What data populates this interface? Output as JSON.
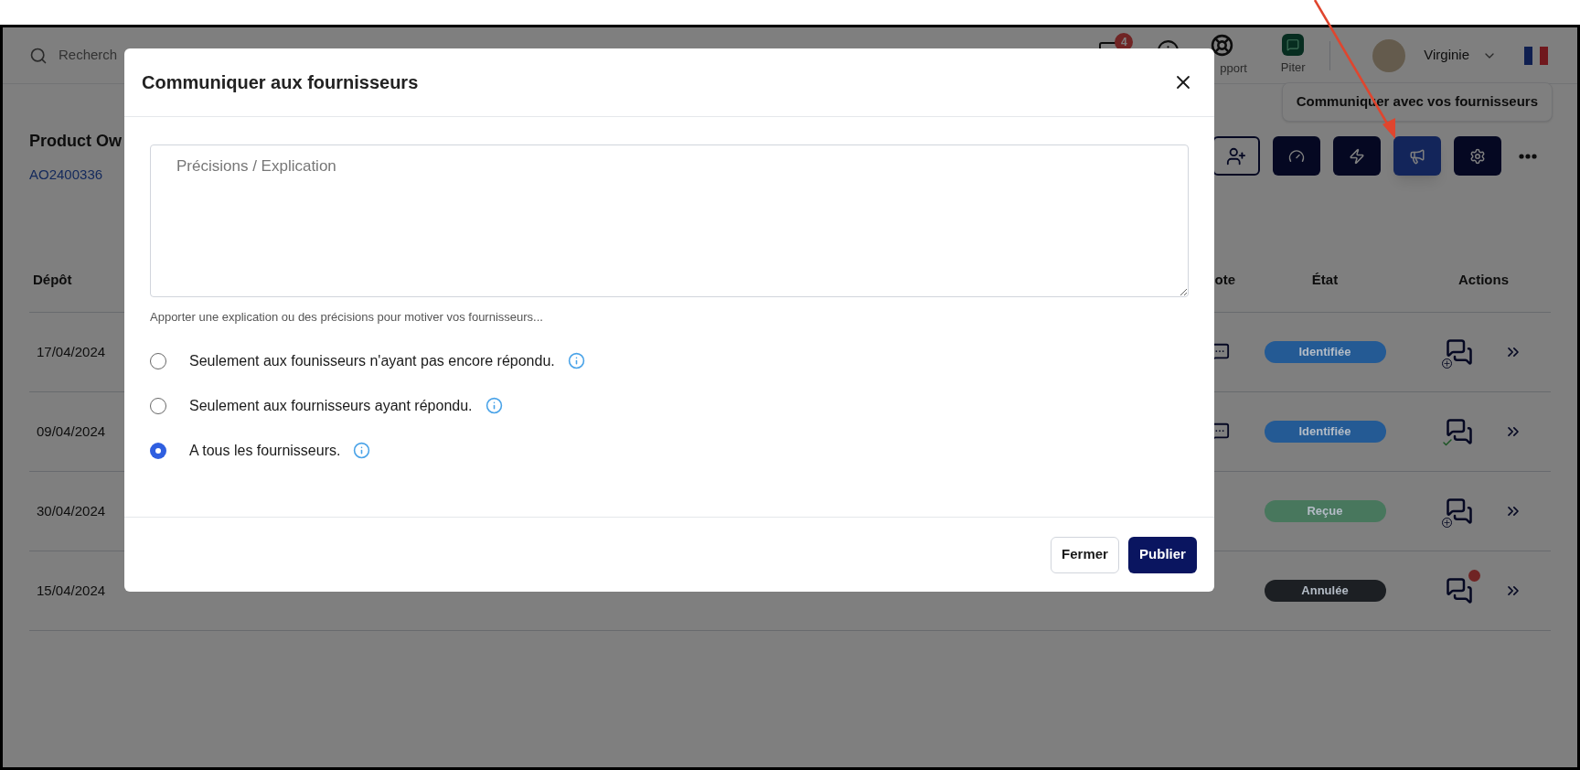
{
  "top_bar": {
    "search": {
      "placeholder": "Recherch"
    },
    "messages_badge": "4",
    "support_label": "pport",
    "piter_label": "Piter",
    "user_name": "Virginie"
  },
  "tooltip": "Communiquer avec vos fournisseurs",
  "toolbar": [
    {
      "kind": "add-user",
      "selected": false
    },
    {
      "kind": "gauge",
      "selected": false
    },
    {
      "kind": "lightning",
      "selected": false
    },
    {
      "kind": "megaphone",
      "selected": true
    },
    {
      "kind": "settings",
      "selected": false
    },
    {
      "kind": "more",
      "selected": false
    }
  ],
  "page": {
    "title": "Product Ow",
    "reference": "AO2400336"
  },
  "table": {
    "columns": [
      "Dépôt",
      "ote",
      "État",
      "Actions"
    ],
    "rows": [
      {
        "date": "17/04/2024",
        "has_note": true,
        "status": "Identifiée",
        "color": "#245a94",
        "kind": "add"
      },
      {
        "date": "09/04/2024",
        "has_note": true,
        "status": "Identifiée",
        "color": "#245a94",
        "kind": "done"
      },
      {
        "date": "30/04/2024",
        "has_note": false,
        "status": "Reçue",
        "color": "#48775d",
        "kind": "add"
      },
      {
        "date": "15/04/2024",
        "has_note": false,
        "status": "Annulée",
        "color": "#1c1f23",
        "kind": "new"
      }
    ]
  },
  "modal": {
    "title": "Communiquer aux fournisseurs",
    "textarea": {
      "placeholder": "Précisions / Explication"
    },
    "helper": "Apporter une explication ou des précisions pour motiver vos fournisseurs...",
    "options": [
      {
        "label": "Seulement aux founisseurs n'ayant pas encore répondu.",
        "selected": false
      },
      {
        "label": "Seulement aux fournisseurs ayant répondu.",
        "selected": false
      },
      {
        "label": "A tous les fournisseurs.",
        "selected": true
      }
    ],
    "buttons": [
      {
        "label": "Fermer",
        "kind": "secondary"
      },
      {
        "label": "Publier",
        "kind": "primary"
      }
    ]
  }
}
